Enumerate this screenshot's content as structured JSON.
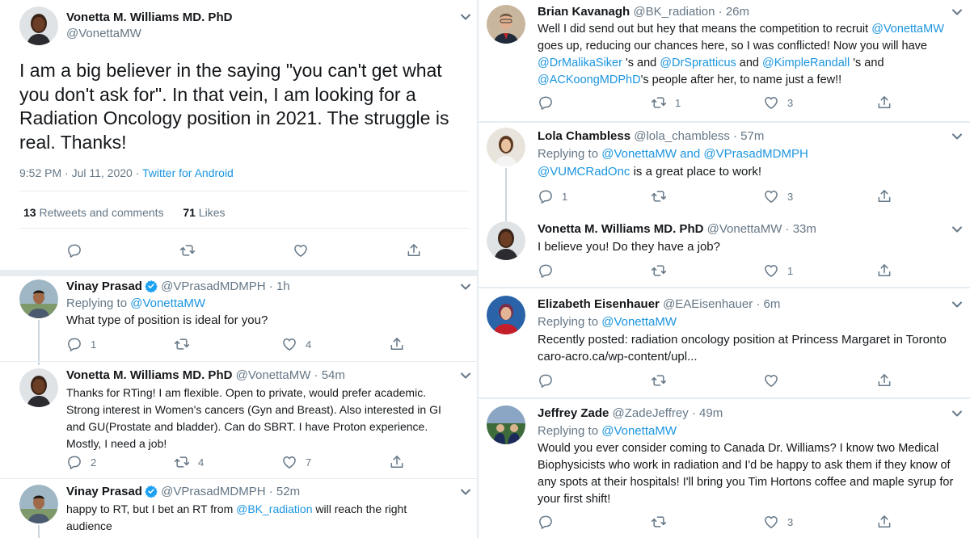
{
  "main_tweet": {
    "author_name": "Vonetta M. Williams MD. PhD",
    "author_handle": "@VonettaMW",
    "text": "I am a big believer in the saying \"you can't get what you don't ask for\". In that vein, I am looking for a Radiation Oncology position in 2021. The struggle is real. Thanks!",
    "time": "9:52 PM · Jul 11, 2020 · ",
    "source": "Twitter for Android",
    "retweets_count": "13",
    "retweets_label": "Retweets and comments",
    "likes_count": "71",
    "likes_label": "Likes"
  },
  "left_replies": [
    {
      "name": "Vinay Prasad",
      "handle": "@VPrasadMDMPH",
      "time": "· 1h",
      "replying_prefix": "Replying to ",
      "replying_to": "@VonettaMW",
      "text": "What type of position is ideal for you?",
      "replies": "1",
      "retweets": "",
      "likes": "4"
    },
    {
      "name": "Vonetta M. Williams MD. PhD",
      "handle": "@VonettaMW",
      "time": "· 54m",
      "text": "Thanks for RTing! I am flexible.  Open to private, would prefer academic. Strong interest in Women's cancers (Gyn and Breast). Also interested in GI and GU(Prostate and bladder). Can do SBRT. I have Proton experience. Mostly,  I need a job!",
      "replies": "2",
      "retweets": "4",
      "likes": "7"
    },
    {
      "name": "Vinay Prasad",
      "handle": "@VPrasadMDMPH",
      "time": "· 52m",
      "text_before": "happy to RT, but I bet an RT from ",
      "mention": "@BK_radiation",
      "text_after": " will reach the right audience"
    }
  ],
  "right_tweets": [
    {
      "name": "Brian Kavanagh",
      "handle": "@BK_radiation",
      "time": "· 26m",
      "text_1": "Well I did send out but hey that means the competition to recruit",
      "mention_1": "@VonettaMW",
      "text_2": " goes up, reducing our chances here, so I was conflicted! Now you will have ",
      "mention_2": "@DrMalikaSiker",
      "text_3": " 's and ",
      "mention_3": "@DrSpratticus",
      "text_4": " and ",
      "mention_4": "@KimpleRandall",
      "text_5": " 's and ",
      "mention_5": "@ACKoongMDPhD",
      "text_6": "'s people after her, to name just a few!!",
      "replies": "",
      "retweets": "1",
      "likes": "3"
    },
    {
      "name": "Lola Chambless",
      "handle": "@lola_chambless",
      "time": "· 57m",
      "replying_prefix": "Replying to ",
      "replying_to": "@VonettaMW",
      "replying_and": " and ",
      "replying_to_2": "@VPrasadMDMPH",
      "mention": "@VUMCRadOnc",
      "text": " is a great place to work!",
      "replies": "1",
      "retweets": "",
      "likes": "3"
    },
    {
      "name": "Vonetta M. Williams MD. PhD",
      "handle": "@VonettaMW",
      "time": "· 33m",
      "text": "I believe you! Do they have a job?",
      "replies": "",
      "retweets": "",
      "likes": "1"
    },
    {
      "name": "Elizabeth Eisenhauer",
      "handle": "@EAEisenhauer",
      "time": "· 6m",
      "replying_prefix": "Replying to ",
      "replying_to": "@VonettaMW",
      "text": "Recently posted: radiation oncology position at Princess Margaret in Toronto",
      "link": "caro-acro.ca/wp-content/upl...",
      "replies": "",
      "retweets": "",
      "likes": ""
    },
    {
      "name": "Jeffrey Zade",
      "handle": "@ZadeJeffrey",
      "time": "· 49m",
      "replying_prefix": "Replying to ",
      "replying_to": "@VonettaMW",
      "text": "Would you ever consider coming to Canada Dr. Williams? I know two Medical Biophysicists who work in radiation and I'd be happy to ask them if they know of any spots at their hospitals! I'll bring you Tim Hortons coffee and maple syrup for your first shift!",
      "replies": "",
      "retweets": "",
      "likes": "3"
    }
  ],
  "icons": {
    "reply": "reply-icon",
    "retweet": "retweet-icon",
    "like": "heart-icon",
    "share": "share-icon",
    "more": "chevron-down-icon",
    "verified": "verified-badge-icon"
  },
  "colors": {
    "link": "#1b95e0",
    "muted": "#657786",
    "text": "#14171a",
    "divider": "#e6ecf0",
    "verified": "#1da1f2"
  }
}
